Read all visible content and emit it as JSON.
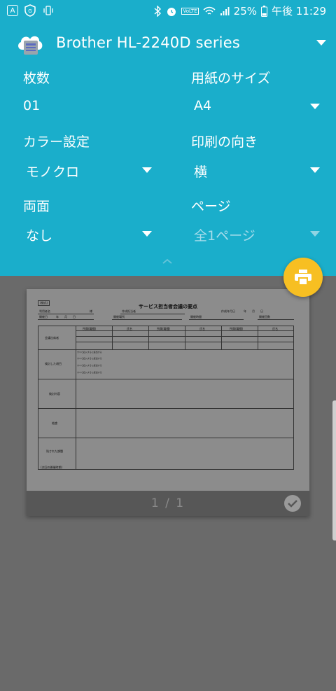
{
  "status_bar": {
    "battery": "25%",
    "time": "午後 11:29",
    "volte": "VoLTE"
  },
  "printer": {
    "name": "Brother HL-2240D series"
  },
  "fields": {
    "copies": {
      "label": "枚数",
      "value": "01"
    },
    "paper_size": {
      "label": "用紙のサイズ",
      "value": "A4"
    },
    "color": {
      "label": "カラー設定",
      "value": "モノクロ"
    },
    "orientation": {
      "label": "印刷の向き",
      "value": "横"
    },
    "duplex": {
      "label": "両面",
      "value": "なし"
    },
    "pages": {
      "label": "ページ",
      "value": "全1ページ"
    }
  },
  "preview": {
    "page_counter": "1 / 1",
    "doc": {
      "tag": "(様式)",
      "title": "サービス担当者会議の要点",
      "meta_left_1": "利用者名",
      "meta_left_1b": "様",
      "meta_mid_1": "作成担当者",
      "meta_right_1": "作成年月日　　　年　　月　　日",
      "meta_left_2": "開催日　　　年　　月　　日",
      "meta_mid_2": "開催場所",
      "meta_mid_2b": "開催時間",
      "meta_right_2": "開催回数",
      "row_attendees": "会議出席者",
      "col_affiliation": "所属(職種)",
      "col_name": "氏名",
      "row_items": "検討した項目",
      "item_line": "すべて記入するに該当する",
      "row_content": "検討内容",
      "row_conclusion": "結論",
      "row_remaining": "残された課題",
      "row_next": "(次回の開催時期)"
    }
  }
}
